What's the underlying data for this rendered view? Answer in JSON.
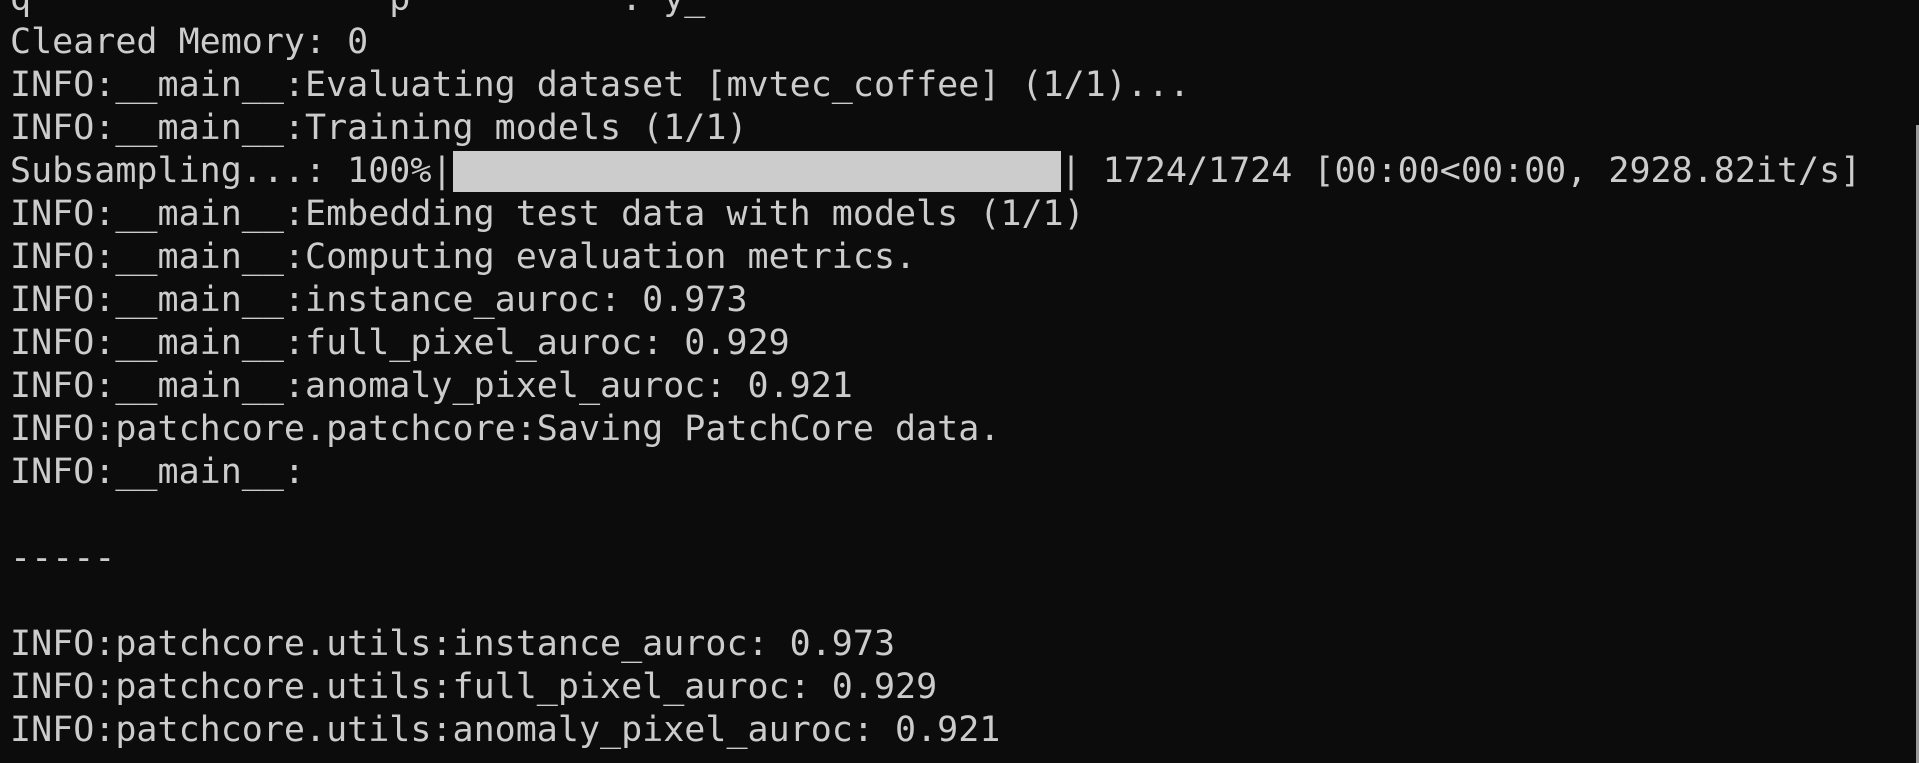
{
  "terminal": {
    "bg_color": "#0c0c0c",
    "fg_color": "#cccccc",
    "cut_line": "q                 p          . y_",
    "lines_before": [
      "Cleared Memory: 0",
      "INFO:__main__:Evaluating dataset [mvtec_coffee] (1/1)...",
      "INFO:__main__:Training models (1/1)"
    ],
    "progress": {
      "label": "Subsampling...: 100%|",
      "fraction": 1.0,
      "suffix": "| 1724/1724 [00:00<00:00, 2928.82it/s]"
    },
    "lines_after": [
      "INFO:__main__:Embedding test data with models (1/1)",
      "INFO:__main__:Computing evaluation metrics.",
      "INFO:__main__:instance_auroc: 0.973",
      "INFO:__main__:full_pixel_auroc: 0.929",
      "INFO:__main__:anomaly_pixel_auroc: 0.921",
      "INFO:patchcore.patchcore:Saving PatchCore data.",
      "INFO:__main__:",
      "",
      "-----",
      "",
      "INFO:patchcore.utils:instance_auroc: 0.973",
      "INFO:patchcore.utils:full_pixel_auroc: 0.929",
      "INFO:patchcore.utils:anomaly_pixel_auroc: 0.921"
    ]
  }
}
